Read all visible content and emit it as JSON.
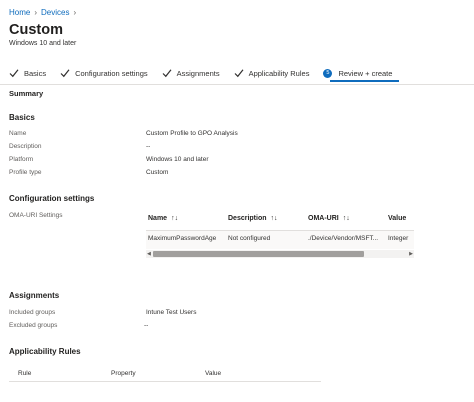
{
  "breadcrumb": {
    "items": [
      "Home",
      "Devices"
    ]
  },
  "page": {
    "title": "Custom",
    "subtitle": "Windows 10 and later"
  },
  "wizard": {
    "steps": [
      {
        "label": "Basics",
        "state": "completed"
      },
      {
        "label": "Configuration settings",
        "state": "completed"
      },
      {
        "label": "Assignments",
        "state": "completed"
      },
      {
        "label": "Applicability Rules",
        "state": "completed"
      },
      {
        "label": "Review + create",
        "state": "current",
        "number": "5"
      }
    ]
  },
  "summary": {
    "heading": "Summary",
    "basics": {
      "heading": "Basics",
      "fields": [
        {
          "label": "Name",
          "value": "Custom Profile to GPO Analysis"
        },
        {
          "label": "Description",
          "value": "--"
        },
        {
          "label": "Platform",
          "value": "Windows 10 and later"
        },
        {
          "label": "Profile type",
          "value": "Custom"
        }
      ]
    },
    "configuration": {
      "heading": "Configuration settings",
      "label": "OMA-URI Settings",
      "table": {
        "columns": [
          "Name",
          "Description",
          "OMA-URI",
          "Value"
        ],
        "rows": [
          [
            "MaximumPasswordAge",
            "Not configured",
            "./Device/Vendor/MSFT...",
            "Integer"
          ]
        ]
      }
    },
    "assignments": {
      "heading": "Assignments",
      "fields": [
        {
          "label": "Included groups",
          "value": "Intune Test Users"
        },
        {
          "label": "Excluded groups",
          "value": "--"
        }
      ]
    },
    "applicability": {
      "heading": "Applicability Rules",
      "columns": [
        "Rule",
        "Property",
        "Value"
      ]
    }
  },
  "colors": {
    "accent": "#0f6cbd",
    "text": "#323130",
    "muted": "#605e5c",
    "divider": "#e1dfdd"
  },
  "icons": {
    "completed_step": "checkmark-icon",
    "sort": "sort-arrows-icon",
    "separator": "chevron-right-icon"
  }
}
